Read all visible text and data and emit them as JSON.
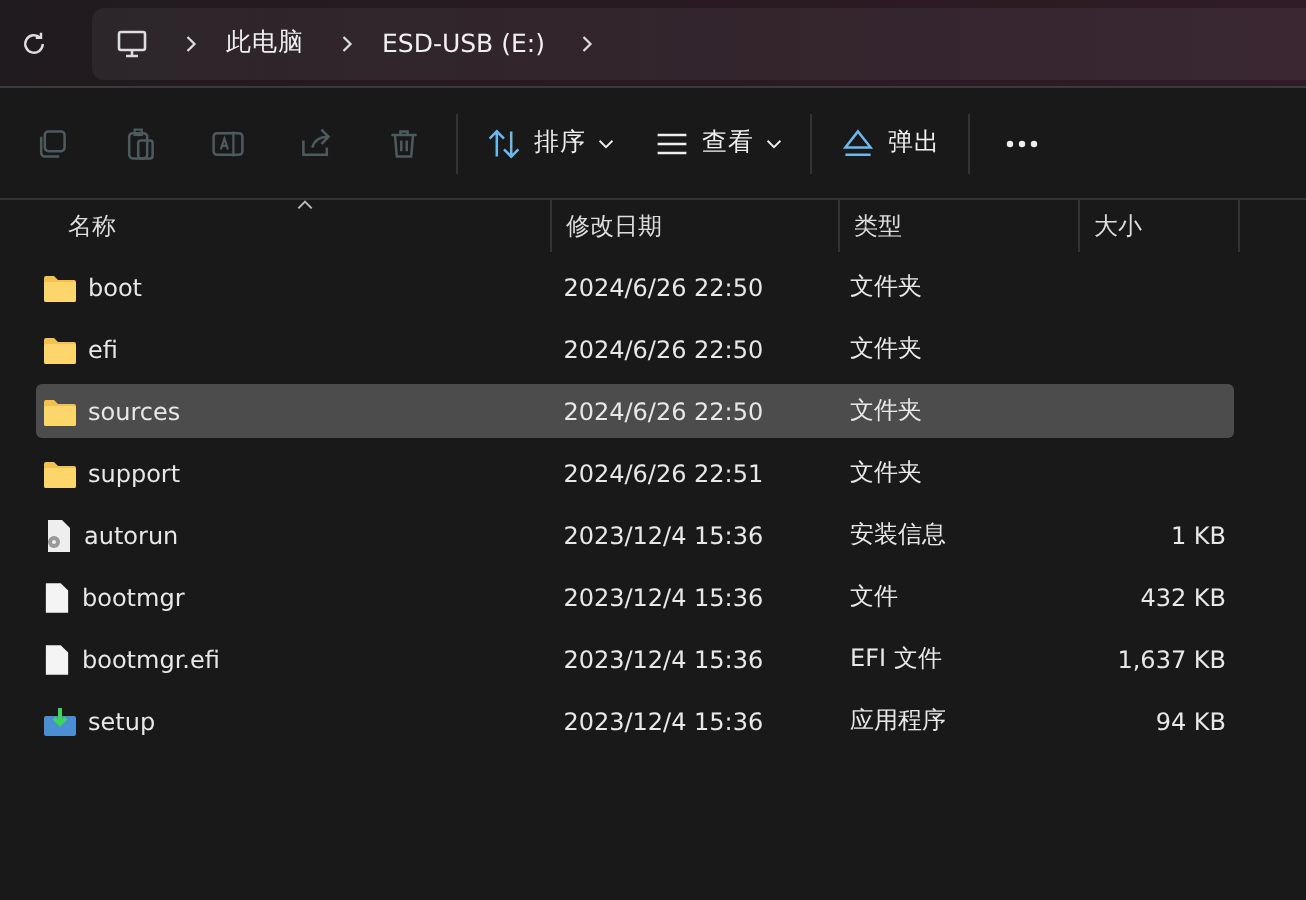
{
  "breadcrumb": [
    "此电脑",
    "ESD-USB (E:)"
  ],
  "toolbar": [
    {
      "kind": "copy",
      "disabled": true
    },
    {
      "kind": "paste",
      "disabled": true
    },
    {
      "kind": "rename",
      "disabled": true
    },
    {
      "kind": "share",
      "disabled": true
    },
    {
      "kind": "delete",
      "disabled": true
    },
    {
      "kind": "sort",
      "label": "排序",
      "disabled": false
    },
    {
      "kind": "view",
      "label": "查看",
      "disabled": false
    },
    {
      "kind": "eject",
      "label": "弹出",
      "disabled": false
    },
    {
      "kind": "more",
      "disabled": false
    }
  ],
  "columns": [
    "名称",
    "修改日期",
    "类型",
    "大小"
  ],
  "rows": [
    {
      "kind": "folder",
      "name": "boot",
      "date": "2024/6/26 22:50",
      "type": "文件夹",
      "selected": false
    },
    {
      "kind": "folder",
      "name": "efi",
      "date": "2024/6/26 22:50",
      "type": "文件夹",
      "selected": false
    },
    {
      "kind": "folder",
      "name": "sources",
      "date": "2024/6/26 22:50",
      "type": "文件夹",
      "selected": true
    },
    {
      "kind": "folder",
      "name": "support",
      "date": "2024/6/26 22:51",
      "type": "文件夹",
      "selected": false
    },
    {
      "kind": "config",
      "name": "autorun",
      "date": "2023/12/4 15:36",
      "type": "安装信息",
      "size": "1 KB",
      "selected": false
    },
    {
      "kind": "file",
      "name": "bootmgr",
      "date": "2023/12/4 15:36",
      "type": "文件",
      "size": "432 KB",
      "selected": false
    },
    {
      "kind": "file",
      "name": "bootmgr.efi",
      "date": "2023/12/4 15:36",
      "type": "EFI 文件",
      "size": "1,637 KB",
      "selected": false
    },
    {
      "kind": "setup",
      "name": "setup",
      "date": "2023/12/4 15:36",
      "type": "应用程序",
      "size": "94 KB",
      "selected": false
    }
  ]
}
